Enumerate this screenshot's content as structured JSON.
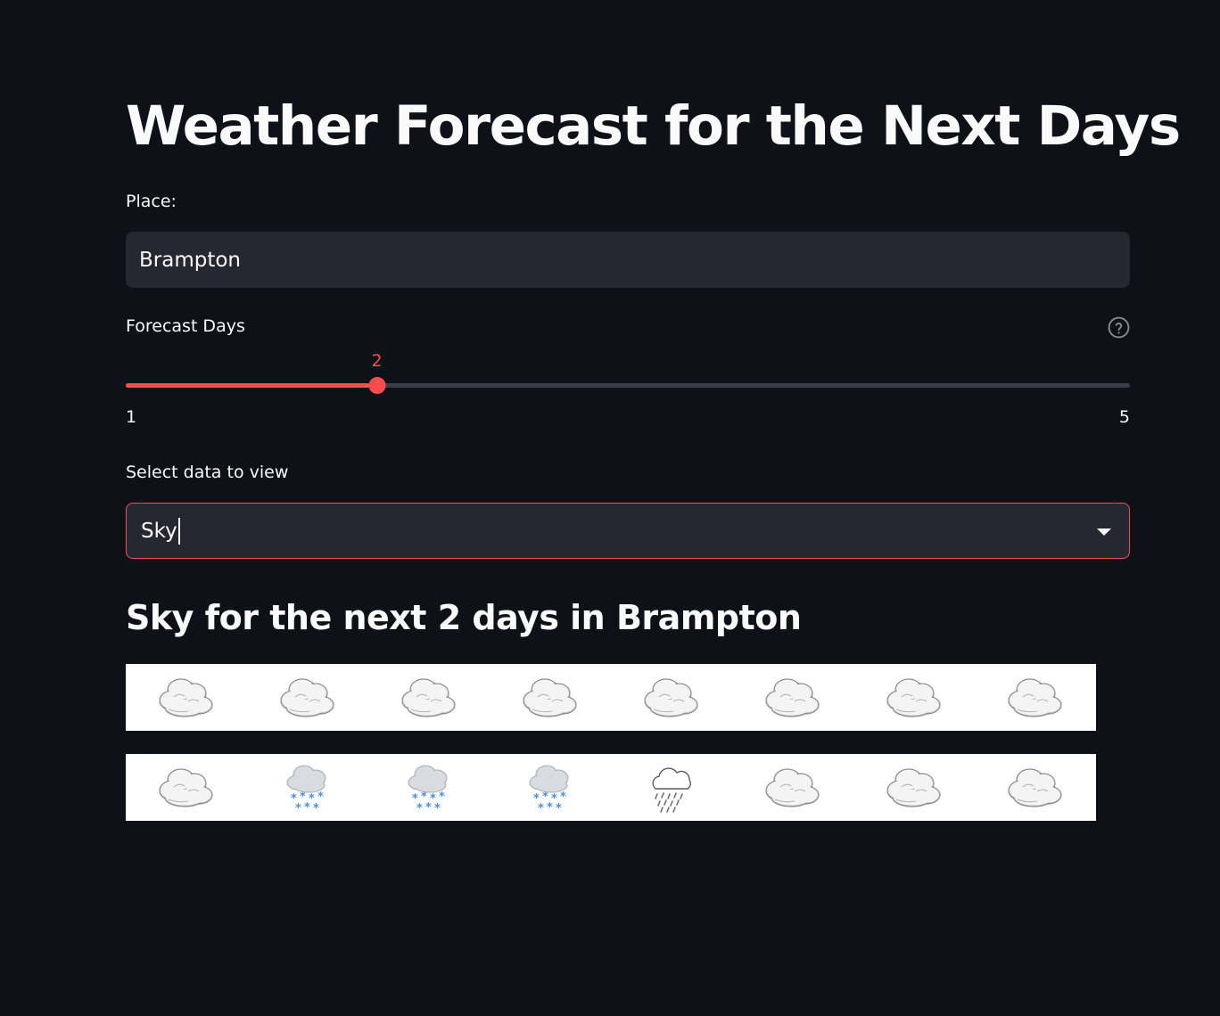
{
  "page": {
    "title": "Weather Forecast for the Next Days"
  },
  "place": {
    "label": "Place:",
    "value": "Brampton"
  },
  "forecast_days": {
    "label": "Forecast Days",
    "value": "2",
    "min": "1",
    "max": "5",
    "help_icon": "question-circle-icon"
  },
  "data_select": {
    "label": "Select data to view",
    "value": "Sky",
    "icon": "chevron-down-icon"
  },
  "result": {
    "heading": "Sky for the next 2 days in Brampton",
    "rows": [
      [
        "cloud",
        "cloud",
        "cloud",
        "cloud",
        "cloud",
        "cloud",
        "cloud",
        "cloud"
      ],
      [
        "cloud",
        "snow",
        "snow",
        "snow",
        "rain",
        "cloud",
        "cloud",
        "cloud"
      ]
    ]
  },
  "colors": {
    "background": "#0e1117",
    "accent": "#ff4b4b",
    "input_bg": "#262730"
  }
}
